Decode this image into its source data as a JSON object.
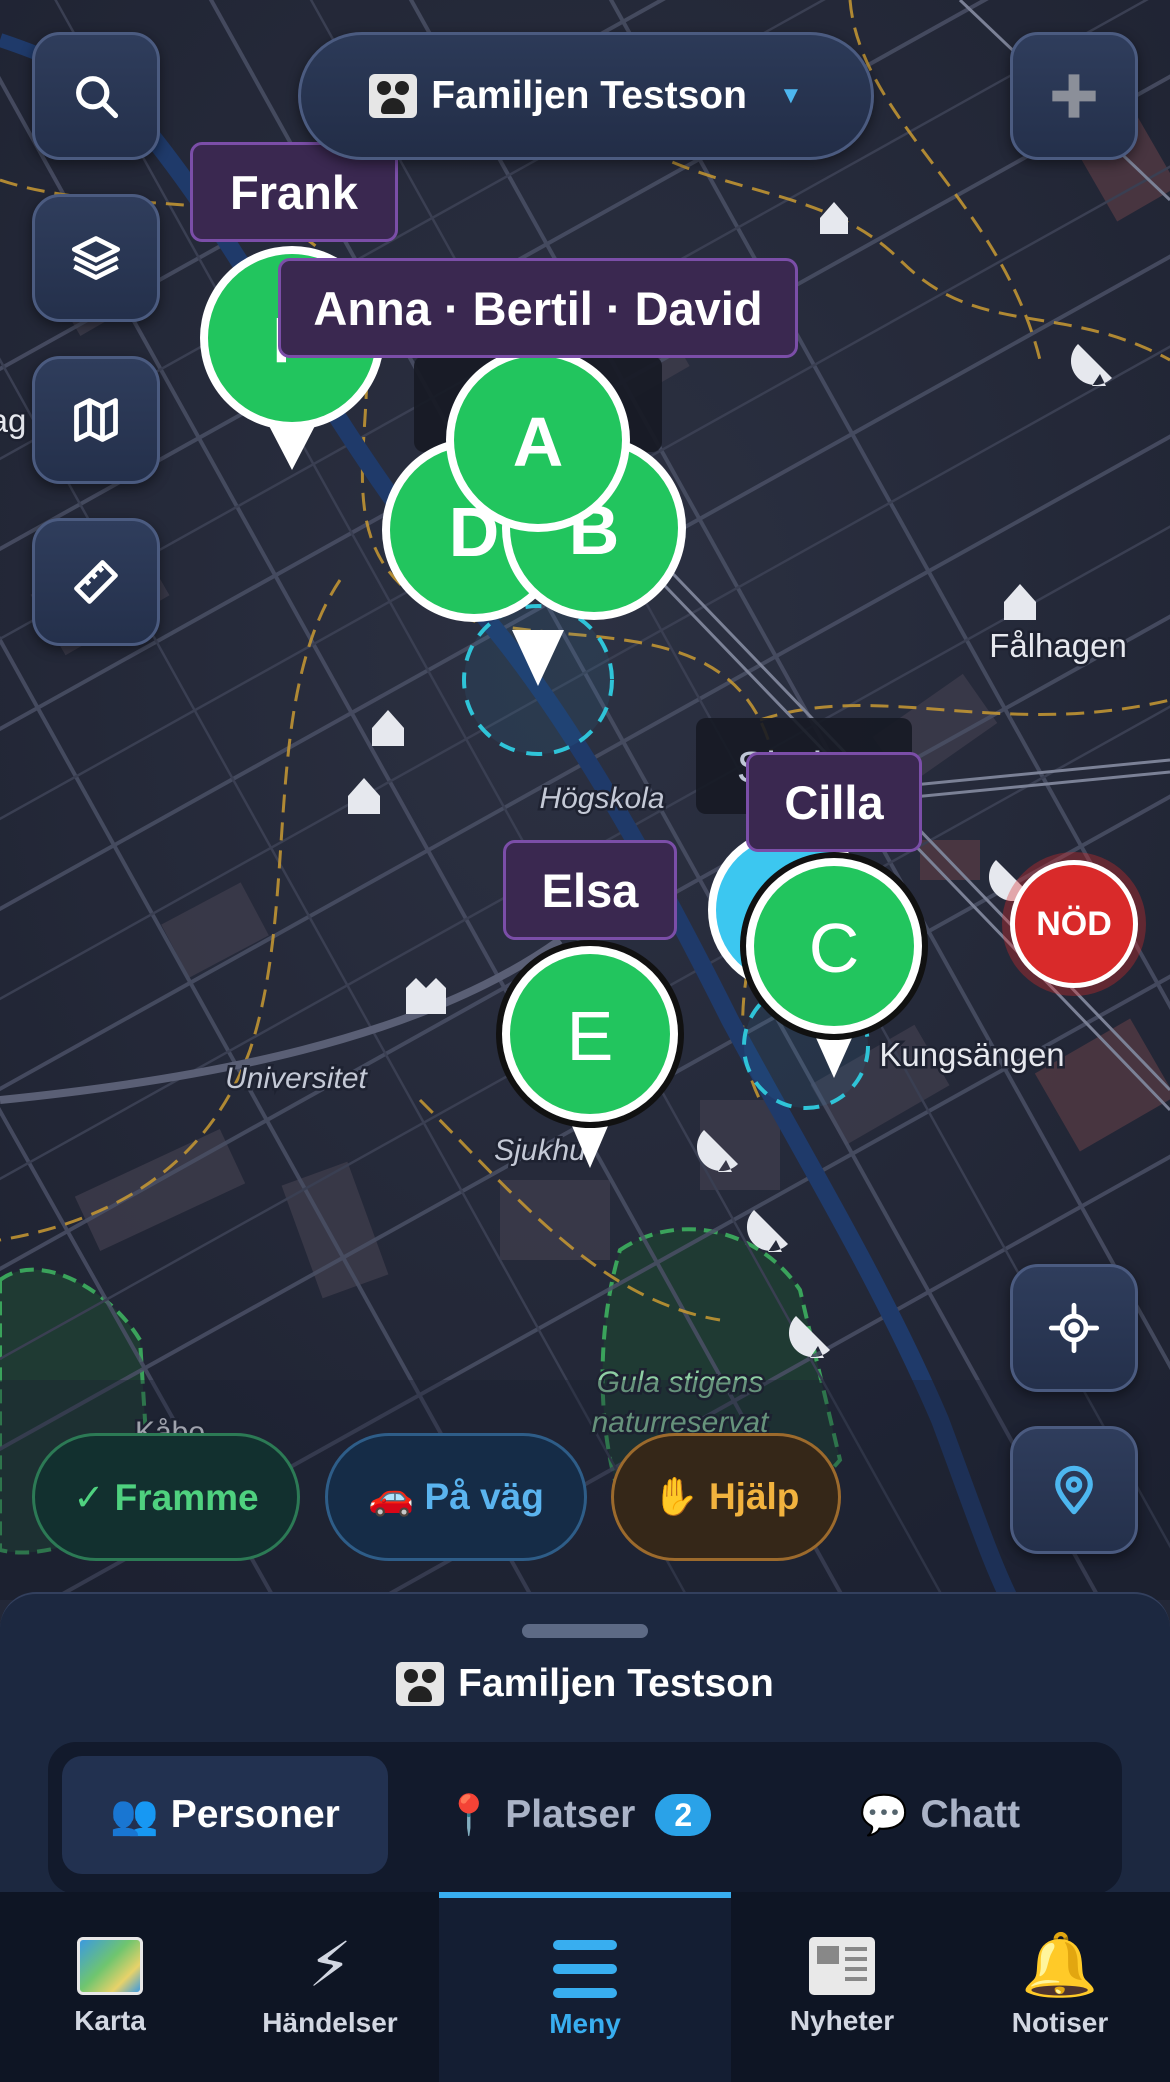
{
  "map": {
    "place_labels": [
      "Fålhagen",
      "Högskola",
      "Universitet",
      "Kungsängen",
      "Sjukhu",
      "Gula stigens",
      "naturreservat",
      "Kåbo",
      "Skolan",
      "ag"
    ]
  },
  "header": {
    "group_name": "Familjen Testson",
    "caret": "▼"
  },
  "markers": {
    "frank": {
      "label": "Frank",
      "initial": "F"
    },
    "cluster": {
      "label": "Anna · Bertil · David",
      "initials": [
        "A",
        "B",
        "D"
      ]
    },
    "cilla": {
      "label": "Cilla",
      "initial": "C"
    },
    "elsa": {
      "label": "Elsa",
      "initial": "E"
    }
  },
  "emergency": {
    "label": "NÖD"
  },
  "status_chips": {
    "framme": "✓ Framme",
    "pavag": "🚗 På väg",
    "hjalp": "✋ Hjälp"
  },
  "sheet": {
    "title": "Familjen Testson",
    "tabs": [
      {
        "icon": "👥",
        "label": "Personer"
      },
      {
        "icon": "📍",
        "label": "Platser",
        "badge": "2"
      },
      {
        "icon": "💬",
        "label": "Chatt"
      }
    ]
  },
  "bottom_nav": [
    {
      "label": "Karta",
      "icon": "map-icon"
    },
    {
      "label": "Händelser",
      "icon": "⚡"
    },
    {
      "label": "Meny",
      "icon": "menu-icon",
      "active": true
    },
    {
      "label": "Nyheter",
      "icon": "news-icon"
    },
    {
      "label": "Notiser",
      "icon": "🔔"
    }
  ],
  "colors": {
    "marker_green": "#22c55e",
    "accent_blue": "#38aef0",
    "label_purple": "#3a2850",
    "emergency_red": "#d92a2a"
  }
}
